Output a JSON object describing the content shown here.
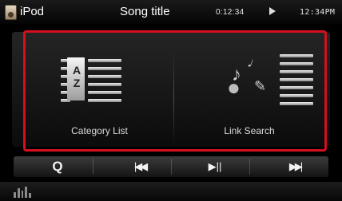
{
  "header": {
    "source_label": "iPod",
    "source_icon": "ipod-icon",
    "song_title": "Song title",
    "elapsed_time": "0:12:34",
    "status_icon": "play-indicator-icon",
    "clock": "12:34PM"
  },
  "main": {
    "category_button": {
      "label": "Category List",
      "icon": "category-list-icon",
      "icon_letters": "A Z"
    },
    "link_button": {
      "label": "Link Search",
      "icon": "link-search-icon"
    }
  },
  "controls": {
    "search_icon": "search-icon",
    "prev_icon": "previous-track-icon",
    "play_pause_icon": "play-pause-icon",
    "next_icon": "next-track-icon",
    "search_glyph": "Q",
    "prev_glyph": "|◀◀",
    "play_pause_glyph": "▶||",
    "next_glyph": "▶▶|"
  },
  "bottom": {
    "eq_icon": "equalizer-icon"
  },
  "colors": {
    "highlight": "#d40f1e",
    "background": "#000000"
  }
}
